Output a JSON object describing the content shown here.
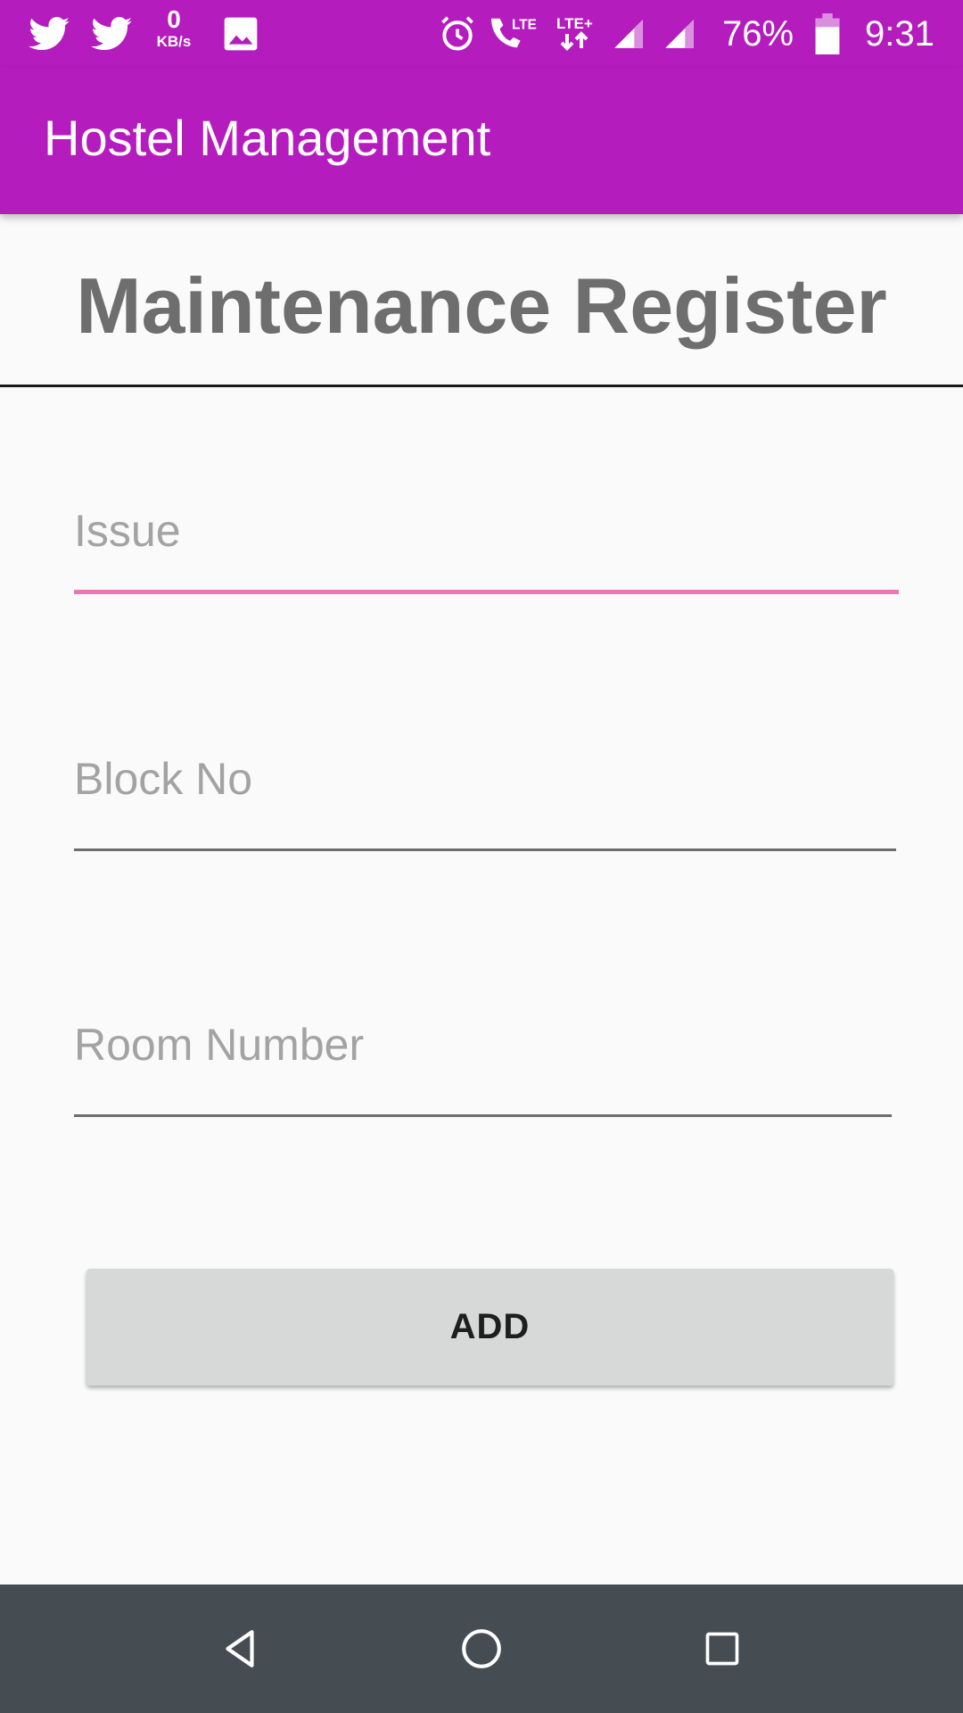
{
  "status_bar": {
    "data_speed_value": "0",
    "data_speed_unit": "KB/s",
    "battery_percent": "76%",
    "time": "9:31",
    "network_labels": [
      "LTE",
      "LTE+"
    ],
    "icons": [
      "twitter-icon",
      "twitter-icon",
      "image-icon",
      "alarm-icon",
      "volte-call-icon",
      "lte-plus-data-icon",
      "signal-icon",
      "signal-icon",
      "battery-icon"
    ]
  },
  "app_bar": {
    "title": "Hostel Management"
  },
  "page": {
    "heading": "Maintenance Register"
  },
  "form": {
    "issue": {
      "value": "",
      "placeholder": "Issue"
    },
    "block_no": {
      "value": "",
      "placeholder": "Block No"
    },
    "room_number": {
      "value": "",
      "placeholder": "Room Number"
    },
    "add_label": "ADD"
  },
  "navigation": {
    "icons": [
      "back-icon",
      "home-icon",
      "recents-icon"
    ]
  },
  "colors": {
    "primary": "#b51cbd",
    "focused_underline": "#e879b4",
    "heading_text": "#6e6e6e",
    "button_bg": "#d7d8d8",
    "nav_bar": "#454c52"
  }
}
